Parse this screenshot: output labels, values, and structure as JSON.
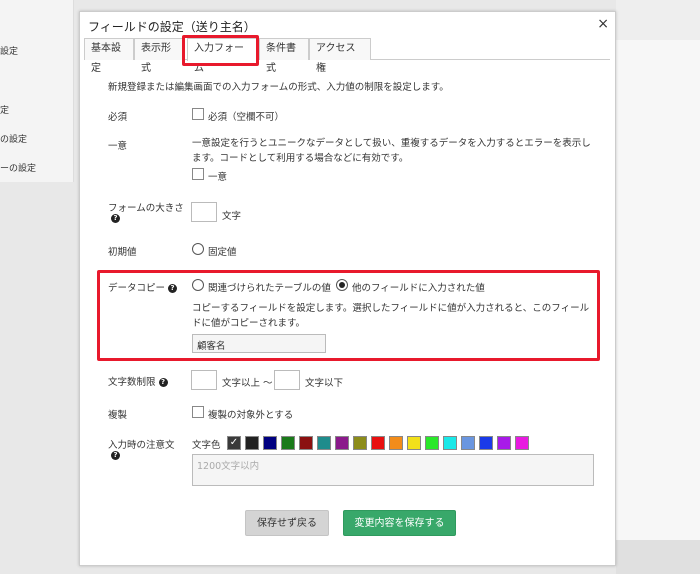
{
  "background": {
    "left_items": [
      "設定",
      "定",
      "の設定",
      "ーの設定"
    ]
  },
  "dialog": {
    "title": "フィールドの設定（送り主名）",
    "close": "×",
    "tabs": [
      "基本設定",
      "表示形式",
      "入力フォーム",
      "条件書式",
      "アクセス権"
    ],
    "active_tab": "入力フォーム",
    "description": "新規登録または編集画面での入力フォームの形式、入力値の制限を設定します。",
    "required": {
      "label": "必須",
      "checkbox_label": "必須（空欄不可）"
    },
    "unique": {
      "label": "一意",
      "text_line1": "一意設定を行うとユニークなデータとして扱い、重複するデータを入力するとエラーを表示し",
      "text_line2": "ます。コードとして利用する場合などに有効です。",
      "checkbox_label": "一意"
    },
    "form_size": {
      "label": "フォームの大きさ",
      "unit": "文字"
    },
    "initial_value": {
      "label": "初期値",
      "radio_label": "固定値"
    },
    "data_copy": {
      "label": "データコピー",
      "option1": "関連づけられたテーブルの値",
      "option2": "他のフィールドに入力された値",
      "selected": "他のフィールドに入力された値",
      "text_line1": "コピーするフィールドを設定します。選択したフィールドに値が入力されると、このフィール",
      "text_line2": "ドに値がコピーされます。",
      "field_value": "顧客名"
    },
    "char_limit": {
      "label": "文字数制限",
      "min_suffix": "文字以上 〜",
      "max_suffix": "文字以下"
    },
    "duplicate": {
      "label": "複製",
      "checkbox_label": "複製の対象外とする"
    },
    "note": {
      "label": "入力時の注意文",
      "color_label": "文字色",
      "colors": [
        "#ffffff",
        "#222222",
        "#000080",
        "#1a7a1a",
        "#8b1010",
        "#1f8c8c",
        "#8b1a8b",
        "#8c8c1a",
        "#e81010",
        "#f28c1a",
        "#f2e01a",
        "#2ae82a",
        "#1ae8e8",
        "#6a96e0",
        "#1a3ae8",
        "#a81ae8",
        "#e81ae0"
      ],
      "placeholder": "1200文字以内"
    },
    "buttons": {
      "back": "保存せず戻る",
      "save": "変更内容を保存する"
    },
    "help_glyph": "?"
  }
}
